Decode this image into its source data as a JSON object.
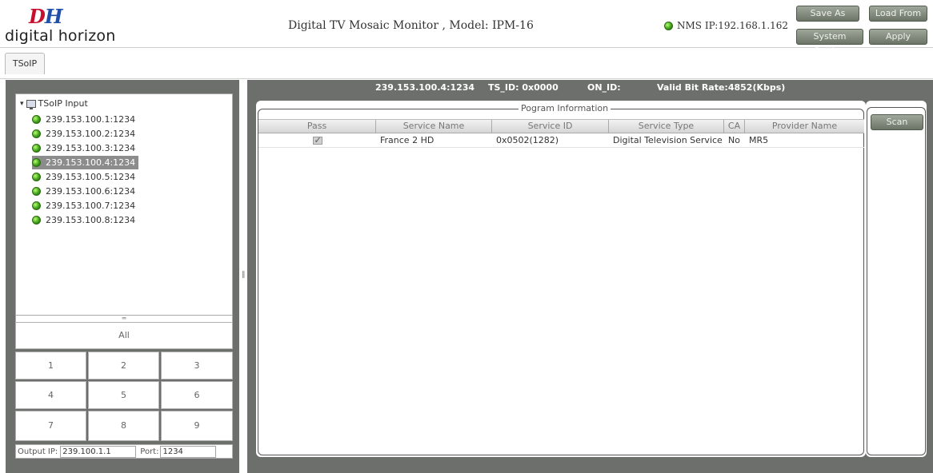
{
  "header": {
    "logo_mark": "DH",
    "logo_text": "digital horizon",
    "app_title": "Digital TV Mosaic Monitor , Model: IPM-16",
    "nms_ip": "NMS IP:192.168.1.162",
    "buttons": {
      "save_as": "Save As",
      "load_from": "Load From",
      "system_setting": "System Setting",
      "apply": "Apply"
    }
  },
  "tabs": [
    {
      "label": "TSoIP",
      "active": true
    }
  ],
  "tree": {
    "root_label": "TSoIP Input",
    "items": [
      {
        "label": "239.153.100.1:1234",
        "status": "green",
        "selected": false
      },
      {
        "label": "239.153.100.2:1234",
        "status": "green",
        "selected": false
      },
      {
        "label": "239.153.100.3:1234",
        "status": "green",
        "selected": false
      },
      {
        "label": "239.153.100.4:1234",
        "status": "green",
        "selected": true
      },
      {
        "label": "239.153.100.5:1234",
        "status": "green",
        "selected": false
      },
      {
        "label": "239.153.100.6:1234",
        "status": "green",
        "selected": false
      },
      {
        "label": "239.153.100.7:1234",
        "status": "green",
        "selected": false
      },
      {
        "label": "239.153.100.8:1234",
        "status": "green",
        "selected": false
      }
    ]
  },
  "grid": {
    "all_label": "All",
    "cells": [
      "1",
      "2",
      "3",
      "4",
      "5",
      "6",
      "7",
      "8",
      "9"
    ]
  },
  "output": {
    "ip_label": "Output IP:",
    "ip_value": "239.100.1.1",
    "port_label": "Port:",
    "port_value": "1234"
  },
  "info": {
    "address": "239.153.100.4:1234",
    "ts_id": "TS_ID: 0x0000",
    "on_id": "ON_ID:",
    "bitrate": "Valid Bit Rate:4852(Kbps)"
  },
  "program": {
    "legend": "Pogram Information",
    "columns": [
      "Pass",
      "Service Name",
      "Service ID",
      "Service Type",
      "CA",
      "Provider Name"
    ],
    "rows": [
      {
        "pass": true,
        "service_name": "France 2 HD",
        "service_id": "0x0502(1282)",
        "service_type": "Digital Television Service",
        "ca": "No",
        "provider_name": "MR5"
      }
    ]
  },
  "side": {
    "scan_label": "Scan"
  },
  "colors": {
    "panel_bg": "#6d6f6c",
    "button_bg": "#7e8779",
    "status_led": "#3ea11c",
    "logo_red": "#c8102e",
    "logo_blue": "#1f4fa8"
  }
}
